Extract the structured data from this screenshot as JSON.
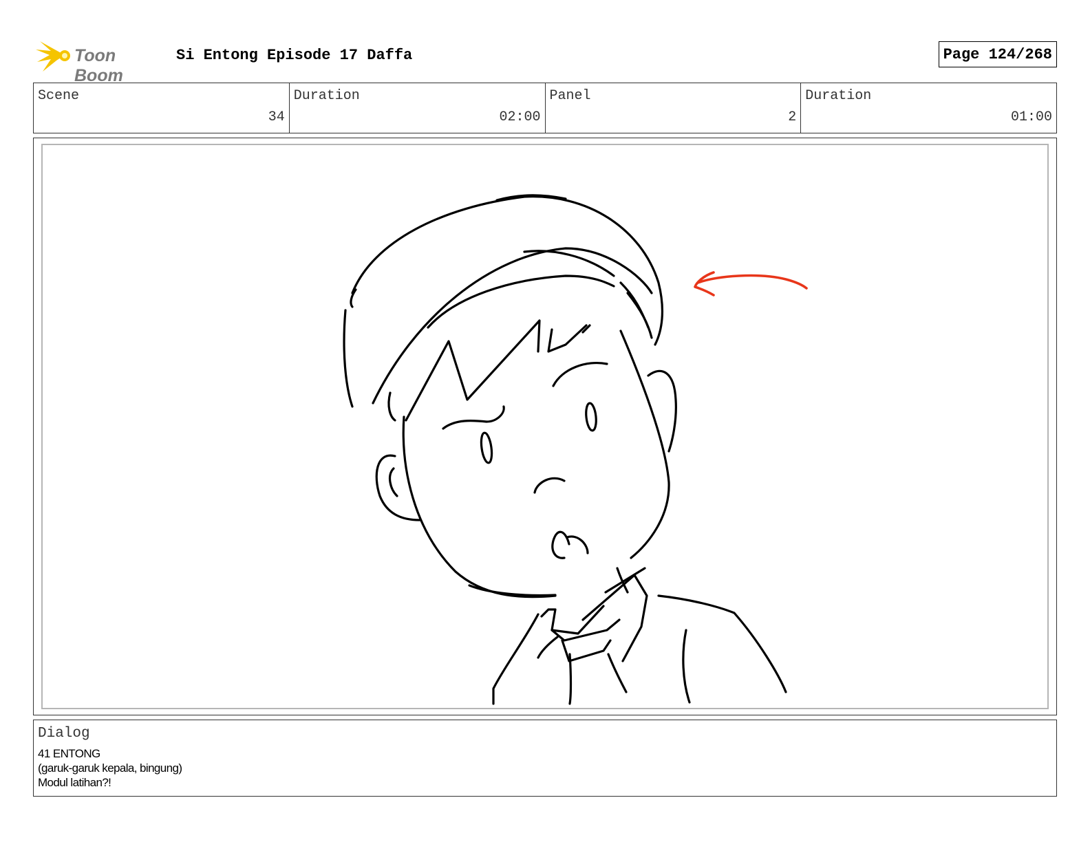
{
  "header": {
    "logo_text": "Toon Boom",
    "title": "Si Entong Episode 17 Daffa",
    "page": "Page 124/268"
  },
  "info": {
    "scene_label": "Scene",
    "scene_value": "34",
    "scene_duration_label": "Duration",
    "scene_duration_value": "02:00",
    "panel_label": "Panel",
    "panel_value": "2",
    "panel_duration_label": "Duration",
    "panel_duration_value": "01:00"
  },
  "dialog": {
    "label": "Dialog",
    "lines": [
      "41 ENTONG",
      "(garuk-garuk kepala, bingung)",
      "Modul latihan?!"
    ]
  },
  "colors": {
    "logo_yellow": "#f5c400",
    "arrow_red": "#e8361a",
    "frame_gray": "#b5b5b5"
  }
}
